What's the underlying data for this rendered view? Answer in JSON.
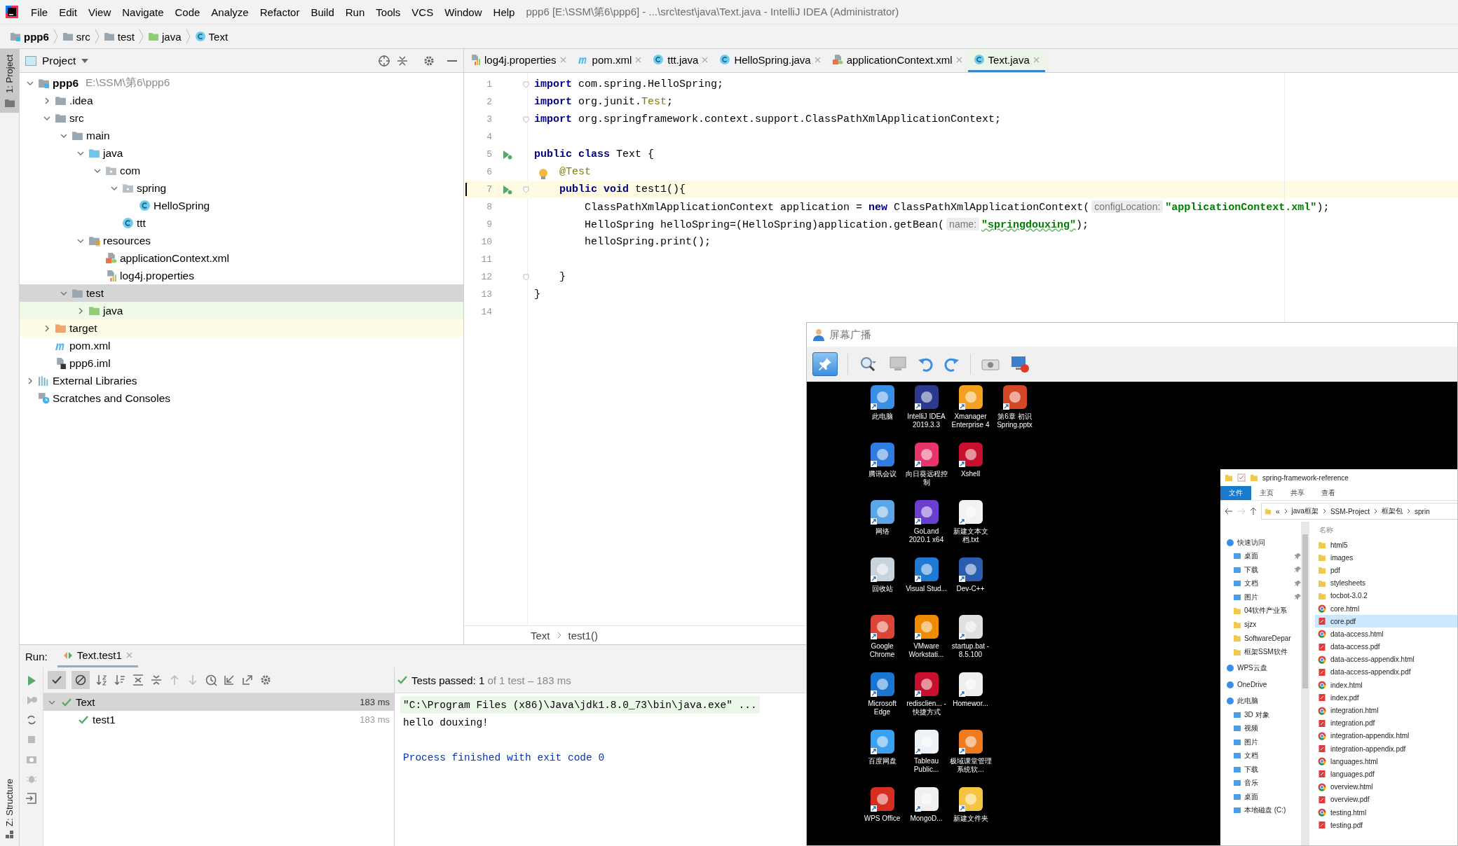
{
  "menu": [
    "File",
    "Edit",
    "View",
    "Navigate",
    "Code",
    "Analyze",
    "Refactor",
    "Build",
    "Run",
    "Tools",
    "VCS",
    "Window",
    "Help"
  ],
  "window": {
    "title": "ppp6 [E:\\SSM\\第6\\ppp6] - ...\\src\\test\\java\\Text.java - IntelliJ IDEA (Administrator)"
  },
  "navigation_bar": [
    {
      "label": "ppp6",
      "kind": "module"
    },
    {
      "label": "src",
      "kind": "folder"
    },
    {
      "label": "test",
      "kind": "folder"
    },
    {
      "label": "java",
      "kind": "test-root"
    },
    {
      "label": "Text",
      "kind": "class"
    }
  ],
  "side_strip": {
    "top": "1: Project",
    "bottom": "Z: Structure"
  },
  "project": {
    "title": "Project",
    "tree": [
      {
        "label": "ppp6",
        "path": "E:\\SSM\\第6\\ppp6",
        "kind": "module",
        "expanded": true,
        "selected": false,
        "children": [
          {
            "label": ".idea",
            "kind": "folder",
            "expanded": false,
            "selected": false
          },
          {
            "label": "src",
            "kind": "folder",
            "expanded": true,
            "selected": false,
            "children": [
              {
                "label": "main",
                "kind": "folder",
                "expanded": true,
                "selected": false,
                "children": [
                  {
                    "label": "java",
                    "kind": "source-root",
                    "expanded": true,
                    "selected": false,
                    "children": [
                      {
                        "label": "com",
                        "kind": "package",
                        "expanded": true,
                        "selected": false,
                        "children": [
                          {
                            "label": "spring",
                            "kind": "package",
                            "expanded": true,
                            "selected": false,
                            "children": [
                              {
                                "label": "HelloSpring",
                                "kind": "class",
                                "selected": false
                              }
                            ]
                          },
                          {
                            "label": "ttt",
                            "kind": "class",
                            "selected": false
                          }
                        ]
                      }
                    ]
                  },
                  {
                    "label": "resources",
                    "kind": "resources-root",
                    "expanded": true,
                    "selected": false,
                    "children": [
                      {
                        "label": "applicationContext.xml",
                        "kind": "xml-file",
                        "selected": false
                      },
                      {
                        "label": "log4j.properties",
                        "kind": "properties-file",
                        "selected": false
                      }
                    ]
                  }
                ]
              },
              {
                "label": "test",
                "kind": "folder",
                "expanded": true,
                "selected": true,
                "children": [
                  {
                    "label": "java",
                    "kind": "test-root",
                    "expanded": false,
                    "selected": false
                  }
                ]
              }
            ]
          },
          {
            "label": "target",
            "kind": "excluded-folder",
            "expanded": false,
            "selected": false
          },
          {
            "label": "pom.xml",
            "kind": "maven-file",
            "selected": false
          },
          {
            "label": "ppp6.iml",
            "kind": "module-file",
            "selected": false
          }
        ]
      },
      {
        "label": "External Libraries",
        "kind": "libraries",
        "expanded": false,
        "selected": false
      },
      {
        "label": "Scratches and Consoles",
        "kind": "scratches",
        "selected": false
      }
    ]
  },
  "tabs": [
    {
      "label": "log4j.properties",
      "kind": "properties-file",
      "selected": false
    },
    {
      "label": "pom.xml",
      "kind": "maven-file",
      "selected": false
    },
    {
      "label": "ttt.java",
      "kind": "class",
      "selected": false
    },
    {
      "label": "HelloSpring.java",
      "kind": "class",
      "selected": false
    },
    {
      "label": "applicationContext.xml",
      "kind": "xml-file",
      "selected": false
    },
    {
      "label": "Text.java",
      "kind": "class",
      "selected": true
    }
  ],
  "editor": {
    "lines": [
      {
        "number": "1",
        "tokens": [
          {
            "kind": "keyword",
            "text": "import"
          },
          {
            "kind": "plain",
            "text": " com.spring.HelloSpring;"
          }
        ],
        "run_marker": false,
        "bulb": false,
        "current": false,
        "fold": true
      },
      {
        "number": "2",
        "tokens": [
          {
            "kind": "keyword",
            "text": "import"
          },
          {
            "kind": "plain",
            "text": " org.junit."
          },
          {
            "kind": "annotation",
            "text": "Test"
          },
          {
            "kind": "plain",
            "text": ";"
          }
        ],
        "run_marker": false,
        "bulb": false,
        "current": false,
        "fold": false
      },
      {
        "number": "3",
        "tokens": [
          {
            "kind": "keyword",
            "text": "import"
          },
          {
            "kind": "plain",
            "text": " org.springframework.context.support.ClassPathXmlApplicationContext;"
          }
        ],
        "run_marker": false,
        "bulb": false,
        "current": false,
        "fold": true
      },
      {
        "number": "4",
        "run_marker": false,
        "bulb": false,
        "current": false,
        "fold": false
      },
      {
        "number": "5",
        "tokens": [
          {
            "kind": "keyword",
            "text": "public class"
          },
          {
            "kind": "plain",
            "text": " Text {"
          }
        ],
        "run_marker": true,
        "bulb": false,
        "current": false,
        "fold": false
      },
      {
        "number": "6",
        "tokens": [
          {
            "kind": "annotation",
            "text": "    @Test"
          }
        ],
        "run_marker": false,
        "bulb": true,
        "current": false,
        "fold": false
      },
      {
        "number": "7",
        "tokens": [
          {
            "kind": "keyword",
            "text": "    public void"
          },
          {
            "kind": "plain",
            "text": " test1(){"
          }
        ],
        "run_marker": true,
        "bulb": false,
        "current": true,
        "fold": true
      },
      {
        "number": "8",
        "tokens": [
          {
            "kind": "plain",
            "text": "        ClassPathXmlApplicationContext application = "
          },
          {
            "kind": "keyword",
            "text": "new"
          },
          {
            "kind": "plain",
            "text": " ClassPathXmlApplicationContext("
          },
          {
            "kind": "hint",
            "text": "configLocation:"
          },
          {
            "kind": "string",
            "text": "\"applicationContext.xml\""
          },
          {
            "kind": "plain",
            "text": ");"
          }
        ],
        "run_marker": false,
        "bulb": false,
        "current": false,
        "fold": false
      },
      {
        "number": "9",
        "tokens": [
          {
            "kind": "plain",
            "text": "        HelloSpring helloSpring=(HelloSpring)application.getBean("
          },
          {
            "kind": "hint",
            "text": "name:"
          },
          {
            "kind": "typo-string",
            "text": "\"springdouxing\""
          },
          {
            "kind": "plain",
            "text": ");"
          }
        ],
        "run_marker": false,
        "bulb": false,
        "current": false,
        "fold": false
      },
      {
        "number": "10",
        "tokens": [
          {
            "kind": "plain",
            "text": "        helloSpring.print();"
          }
        ],
        "run_marker": false,
        "bulb": false,
        "current": false,
        "fold": false
      },
      {
        "number": "11",
        "run_marker": false,
        "bulb": false,
        "current": false,
        "fold": false
      },
      {
        "number": "12",
        "tokens": [
          {
            "kind": "plain",
            "text": "    }"
          }
        ],
        "run_marker": false,
        "bulb": false,
        "current": false,
        "fold": true
      },
      {
        "number": "13",
        "tokens": [
          {
            "kind": "plain",
            "text": "}"
          }
        ],
        "run_marker": false,
        "bulb": false,
        "current": false,
        "fold": false
      },
      {
        "number": "14",
        "run_marker": false,
        "bulb": false,
        "current": false,
        "fold": false
      }
    ],
    "breadcrumb": [
      "Text",
      "test1()"
    ]
  },
  "run": {
    "label": "Run:",
    "tab": "Text.test1",
    "filters": [
      {
        "selected": true
      },
      {
        "selected": true
      }
    ],
    "status": "Tests passed: 1",
    "status_detail": "of 1 test – 183 ms",
    "tests": [
      {
        "label": "Text",
        "time": "183 ms",
        "passed": true,
        "expanded": true,
        "selected": true,
        "children": [
          {
            "label": "test1",
            "time": "183 ms",
            "passed": true,
            "selected": false
          }
        ]
      }
    ],
    "console": [
      {
        "kind": "command",
        "text": "\"C:\\Program Files (x86)\\Java\\jdk1.8.0_73\\bin\\java.exe\" ..."
      },
      {
        "kind": "stdout",
        "text": "hello douxing!"
      },
      {
        "kind": "system",
        "text": "Process finished with exit code 0"
      }
    ]
  },
  "broadcast": {
    "title": "屏幕广播",
    "pinned": true,
    "desktop": [
      {
        "label": "此电脑"
      },
      {
        "label": "腾讯会议"
      },
      {
        "label": "网络"
      },
      {
        "label": "回收站"
      },
      {
        "label": "Google Chrome"
      },
      {
        "label": "Microsoft Edge"
      },
      {
        "label": "百度网盘"
      },
      {
        "label": "WPS Office"
      },
      {
        "label": "IntelliJ IDEA 2019.3.3"
      },
      {
        "label": "向日葵远程控制"
      },
      {
        "label": "GoLand 2020.1 x64"
      },
      {
        "label": "Visual Stud..."
      },
      {
        "label": "VMware Workstati..."
      },
      {
        "label": "redisclien... - 快捷方式"
      },
      {
        "label": "Tableau Public..."
      },
      {
        "label": "MongoD..."
      },
      {
        "label": "Xmanager Enterprise 4"
      },
      {
        "label": "Xshell"
      },
      {
        "label": "新建文本文档.txt"
      },
      {
        "label": "Dev-C++"
      },
      {
        "label": "startup.bat - 8.5.100"
      },
      {
        "label": "Homewor..."
      },
      {
        "label": "极域课堂管理系统软..."
      },
      {
        "label": "新建文件夹"
      },
      {
        "label": "第6章 初识 Spring.pptx"
      }
    ],
    "explorer": {
      "title": "spring-framework-reference",
      "ribbon": [
        {
          "label": "文件",
          "selected": true
        },
        {
          "label": "主页",
          "selected": false
        },
        {
          "label": "共享",
          "selected": false
        },
        {
          "label": "查看",
          "selected": false
        }
      ],
      "address": [
        "«",
        "java框架",
        "SSM-Project",
        "框架包",
        "sprin"
      ],
      "nav": [
        {
          "label": "快速访问",
          "kind": "group",
          "pinned": false
        },
        {
          "label": "桌面",
          "kind": "item",
          "pinned": true
        },
        {
          "label": "下载",
          "kind": "item",
          "pinned": true
        },
        {
          "label": "文档",
          "kind": "item",
          "pinned": true
        },
        {
          "label": "图片",
          "kind": "item",
          "pinned": true
        },
        {
          "label": "04软件产业系",
          "kind": "folder",
          "pinned": false
        },
        {
          "label": "sjzx",
          "kind": "folder",
          "pinned": false
        },
        {
          "label": "SoftwareDepar",
          "kind": "folder",
          "pinned": false
        },
        {
          "label": "框架SSM软件",
          "kind": "folder",
          "pinned": false
        },
        {
          "label": "WPS云盘",
          "kind": "group",
          "pinned": false
        },
        {
          "label": "OneDrive",
          "kind": "group",
          "pinned": false
        },
        {
          "label": "此电脑",
          "kind": "group",
          "pinned": false
        },
        {
          "label": "3D 对象",
          "kind": "item",
          "pinned": false
        },
        {
          "label": "视频",
          "kind": "item",
          "pinned": false
        },
        {
          "label": "图片",
          "kind": "item",
          "pinned": false
        },
        {
          "label": "文档",
          "kind": "item",
          "pinned": false
        },
        {
          "label": "下载",
          "kind": "item",
          "pinned": false
        },
        {
          "label": "音乐",
          "kind": "item",
          "pinned": false
        },
        {
          "label": "桌面",
          "kind": "item",
          "pinned": false
        },
        {
          "label": "本地磁盘 (C:)",
          "kind": "item",
          "pinned": false
        }
      ],
      "column": "名称",
      "files": [
        {
          "name": "html5",
          "kind": "folder",
          "selected": false
        },
        {
          "name": "images",
          "kind": "folder",
          "selected": false
        },
        {
          "name": "pdf",
          "kind": "folder",
          "selected": false
        },
        {
          "name": "stylesheets",
          "kind": "folder",
          "selected": false
        },
        {
          "name": "tocbot-3.0.2",
          "kind": "folder",
          "selected": false
        },
        {
          "name": "core.html",
          "kind": "html",
          "selected": false
        },
        {
          "name": "core.pdf",
          "kind": "pdf",
          "selected": true
        },
        {
          "name": "data-access.html",
          "kind": "html",
          "selected": false
        },
        {
          "name": "data-access.pdf",
          "kind": "pdf",
          "selected": false
        },
        {
          "name": "data-access-appendix.html",
          "kind": "html",
          "selected": false
        },
        {
          "name": "data-access-appendix.pdf",
          "kind": "pdf",
          "selected": false
        },
        {
          "name": "index.html",
          "kind": "html",
          "selected": false
        },
        {
          "name": "index.pdf",
          "kind": "pdf",
          "selected": false
        },
        {
          "name": "integration.html",
          "kind": "html",
          "selected": false
        },
        {
          "name": "integration.pdf",
          "kind": "pdf",
          "selected": false
        },
        {
          "name": "integration-appendix.html",
          "kind": "html",
          "selected": false
        },
        {
          "name": "integration-appendix.pdf",
          "kind": "pdf",
          "selected": false
        },
        {
          "name": "languages.html",
          "kind": "html",
          "selected": false
        },
        {
          "name": "languages.pdf",
          "kind": "pdf",
          "selected": false
        },
        {
          "name": "overview.html",
          "kind": "html",
          "selected": false
        },
        {
          "name": "overview.pdf",
          "kind": "pdf",
          "selected": false
        },
        {
          "name": "testing.html",
          "kind": "html",
          "selected": false
        },
        {
          "name": "testing.pdf",
          "kind": "pdf",
          "selected": false
        }
      ]
    }
  }
}
